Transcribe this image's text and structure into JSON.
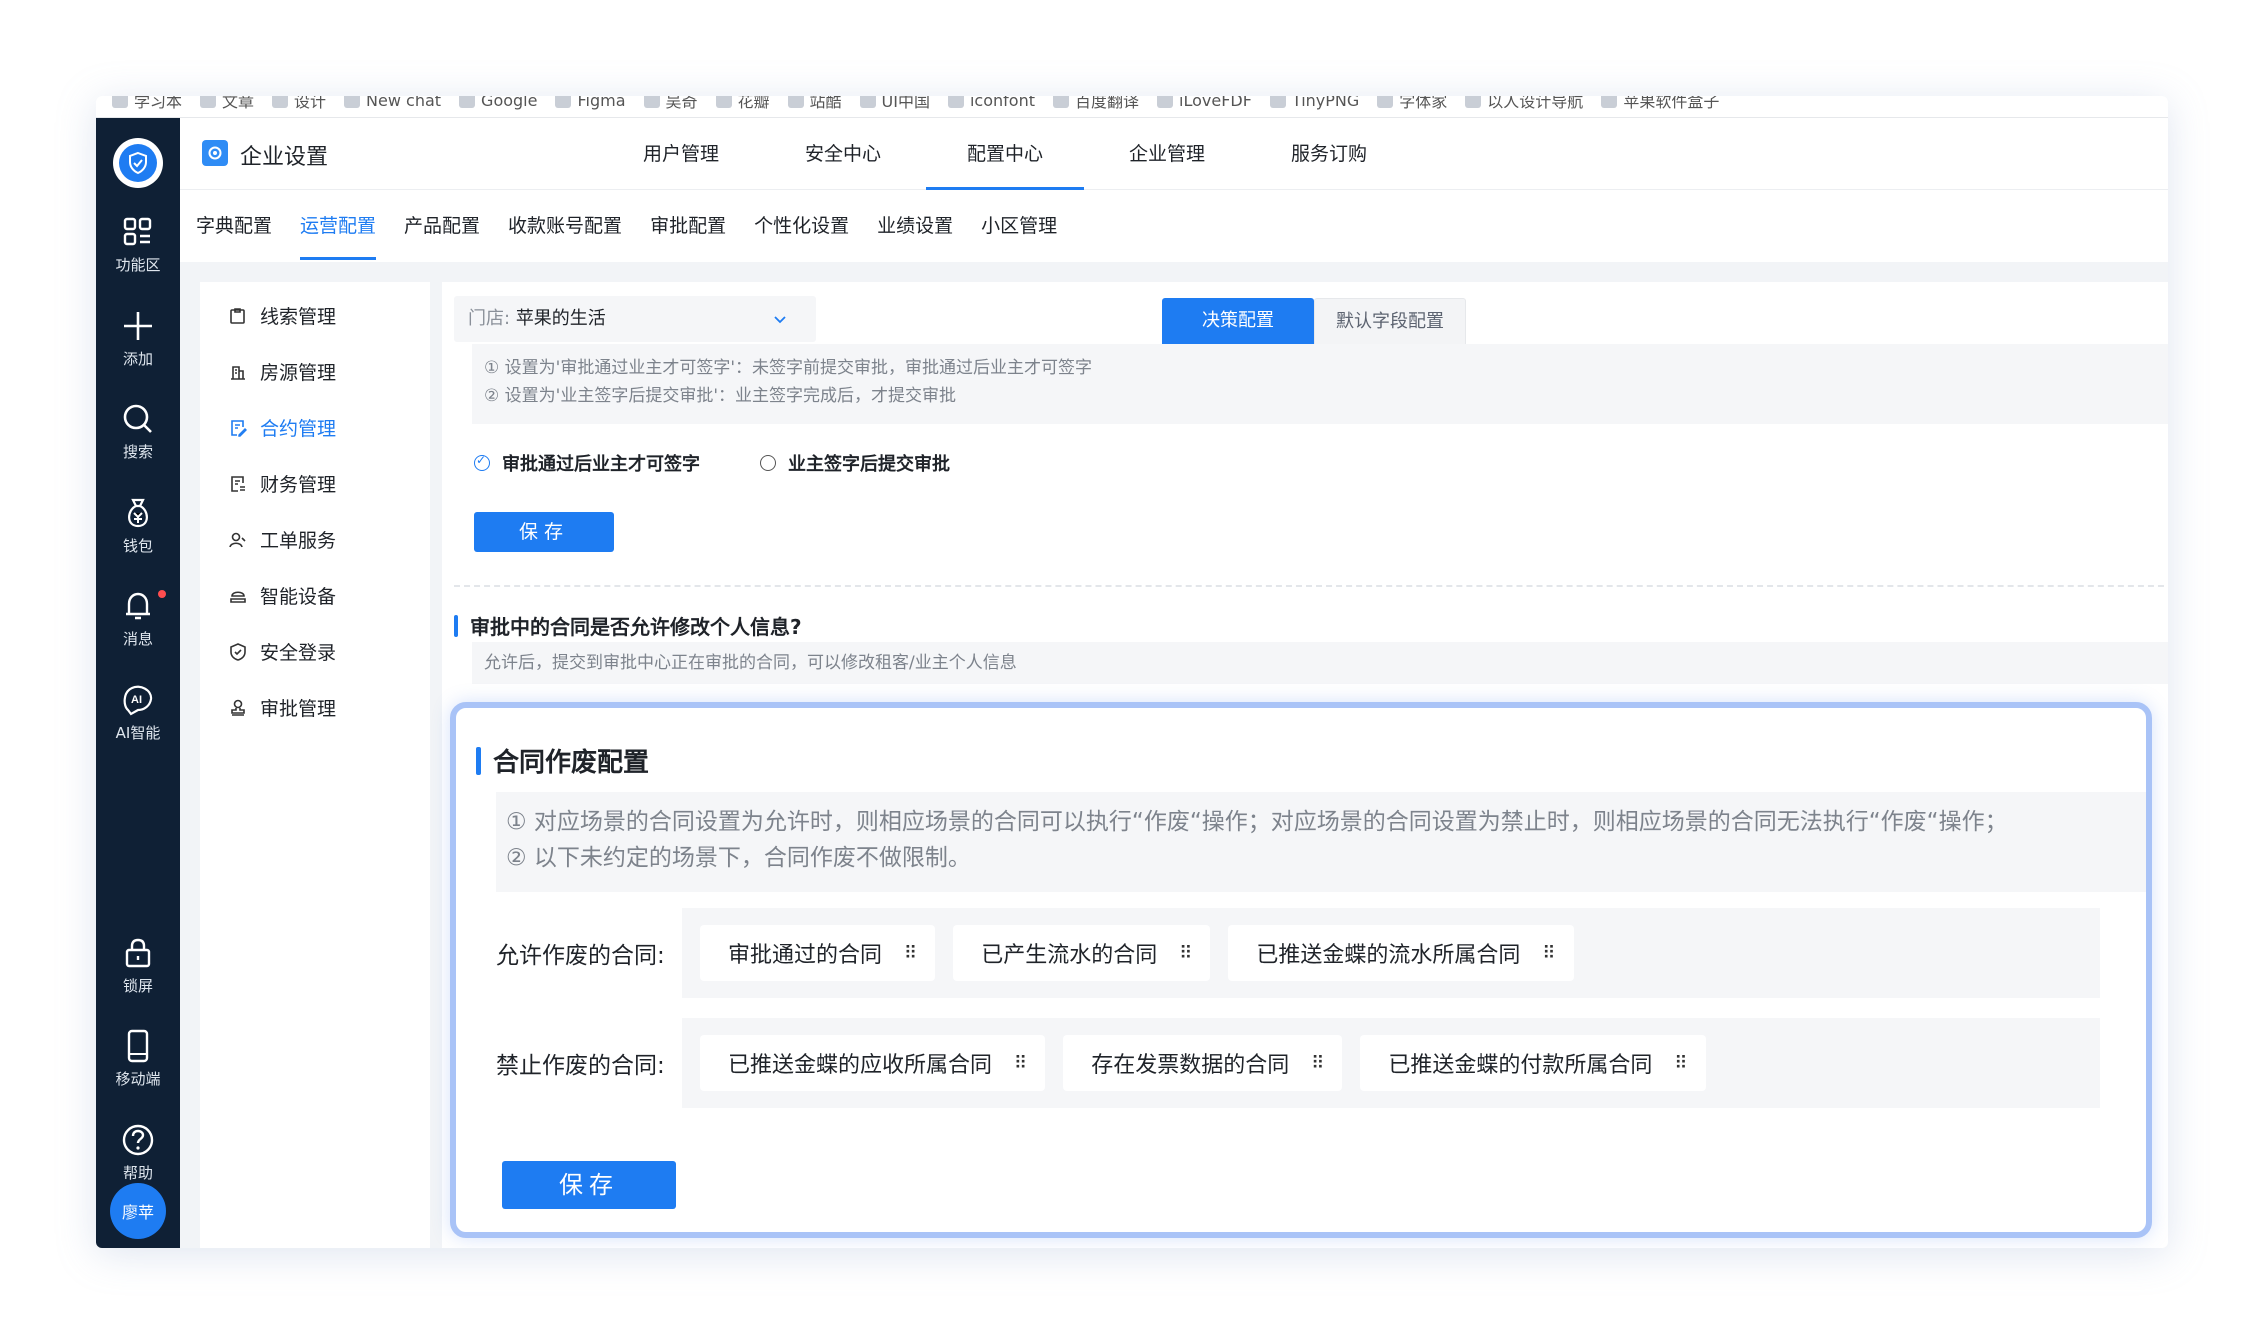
{
  "bookmarks": [
    "学习本",
    "文章",
    "设计",
    "New chat",
    "Google",
    "Figma",
    "吴奇",
    "花瓣",
    "站酷",
    "UI中国",
    "iconfont",
    "百度翻译",
    "iLoveFDF",
    "TinyPNG",
    "字体家",
    "以人设计导航",
    "苹果软件盒子"
  ],
  "rail": {
    "items": [
      {
        "label": "功能区"
      },
      {
        "label": "添加"
      },
      {
        "label": "搜索"
      },
      {
        "label": "钱包"
      },
      {
        "label": "消息"
      },
      {
        "label": "AI智能"
      },
      {
        "label": "锁屏"
      },
      {
        "label": "移动端"
      },
      {
        "label": "帮助"
      }
    ],
    "avatar": "廖苹"
  },
  "header": {
    "title": "企业设置",
    "nav": [
      "用户管理",
      "安全中心",
      "配置中心",
      "企业管理",
      "服务订购"
    ],
    "active_nav": "配置中心"
  },
  "subtabs": {
    "items": [
      "字典配置",
      "运营配置",
      "产品配置",
      "收款账号配置",
      "审批配置",
      "个性化设置",
      "业绩设置",
      "小区管理"
    ],
    "active": "运营配置"
  },
  "menu": {
    "items": [
      "线索管理",
      "房源管理",
      "合约管理",
      "财务管理",
      "工单服务",
      "智能设备",
      "安全登录",
      "审批管理"
    ],
    "active": "合约管理"
  },
  "content": {
    "store_prefix": "门店:",
    "store_value": "苹果的生活",
    "tabs": [
      "决策配置",
      "默认字段配置"
    ],
    "tip1_line1": "① 设置为'审批通过业主才可签字'：未签字前提交审批，审批通过后业主才可签字",
    "tip1_line2": "② 设置为'业主签字后提交审批'：业主签字完成后，才提交审批",
    "radio1": "审批通过后业主才可签字",
    "radio2": "业主签字后提交审批",
    "save": "保存",
    "section1_title": "审批中的合同是否允许修改个人信息?",
    "section1_tip": "允许后，提交到审批中心正在审批的合同，可以修改租客/业主个人信息"
  },
  "card": {
    "title": "合同作废配置",
    "tip_line1": "① 对应场景的合同设置为允许时，则相应场景的合同可以执行“作废“操作；对应场景的合同设置为禁止时，则相应场景的合同无法执行“作废“操作；",
    "tip_line2": "② 以下未约定的场景下，合同作废不做限制。",
    "allow_label": "允许作废的合同:",
    "allow_chips": [
      "审批通过的合同",
      "已产生流水的合同",
      "已推送金蝶的流水所属合同"
    ],
    "forbid_label": "禁止作废的合同:",
    "forbid_chips": [
      "已推送金蝶的应收所属合同",
      "存在发票数据的合同",
      "已推送金蝶的付款所属合同"
    ],
    "save": "保存"
  },
  "colors": {
    "accent": "#1e7cf2",
    "rail": "#0f2035",
    "highlight_border": "#a9c3f7"
  }
}
